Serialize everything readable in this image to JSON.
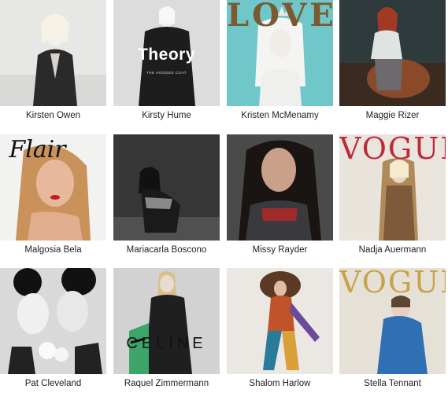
{
  "models": [
    {
      "name": "Kirsten Owen"
    },
    {
      "name": "Kirsty Hume",
      "logo": "Theory",
      "sublabel": "THE HOODED COAT"
    },
    {
      "name": "Kristen McMenamy",
      "logo": "LOVE"
    },
    {
      "name": "Maggie Rizer"
    },
    {
      "name": "Malgosia Bela",
      "logo": "Flair"
    },
    {
      "name": "Mariacarla Boscono"
    },
    {
      "name": "Missy Rayder"
    },
    {
      "name": "Nadja Auermann",
      "logo": "VOGUE"
    },
    {
      "name": "Pat Cleveland"
    },
    {
      "name": "Raquel Zimmermann",
      "logo": "CELINE"
    },
    {
      "name": "Shalom Harlow"
    },
    {
      "name": "Stella Tennant",
      "logo": "VOGUE"
    }
  ],
  "colors": {
    "text": "#222222",
    "love_bg": "#6fc7c9",
    "vogue_red": "#c0283a",
    "vogue_gold": "#c8a24a",
    "blue_dress": "#2f6fb3"
  }
}
